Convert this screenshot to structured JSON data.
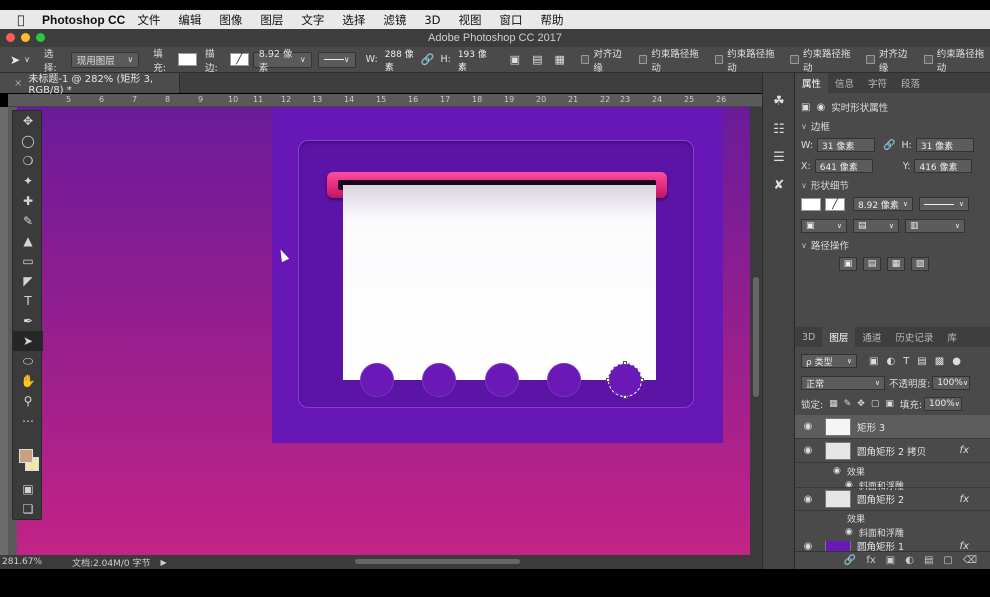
{
  "menu": {
    "app": "Photoshop CC",
    "items": [
      "文件",
      "编辑",
      "图像",
      "图层",
      "文字",
      "选择",
      "滤镜",
      "3D",
      "视图",
      "窗口",
      "帮助"
    ]
  },
  "window": {
    "title": "Adobe Photoshop CC 2017"
  },
  "options": {
    "select_label": "选择:",
    "select_value": "现用图层",
    "fill_label": "填充:",
    "stroke_label": "描边:",
    "stroke_size": "8.92 像素",
    "w_label": "W:",
    "w_value": "288 像素",
    "h_label": "H:",
    "h_value": "193 像素",
    "align_edges": "对齐边缘",
    "constrain_path": "约束路径拖动",
    "constrain_path2": "约束路径拖动",
    "constrain_path3": "约束路径拖动",
    "align_edges2": "对齐边缘",
    "constrain_path4": "约束路径拖动"
  },
  "document": {
    "tab_title": "未标题-1 @ 282% (矩形 3, RGB/8) *",
    "ruler_ticks": [
      "5",
      "6",
      "7",
      "8",
      "9",
      "10",
      "11",
      "12",
      "13",
      "14",
      "15",
      "16",
      "17",
      "18",
      "19",
      "20",
      "21",
      "22",
      "23",
      "24",
      "25",
      "26"
    ]
  },
  "status": {
    "zoom": "281.67%",
    "doc_info": "文档:2.04M/0 字节"
  },
  "properties": {
    "tabs": [
      "属性",
      "信息",
      "字符",
      "段落"
    ],
    "header": "实时形状属性",
    "section_frame": "边框",
    "w_label": "W:",
    "w": "31 像素",
    "h_label": "H:",
    "h": "31 像素",
    "x_label": "X:",
    "x": "641 像素",
    "y_label": "Y:",
    "y": "416 像素",
    "section_shape": "形状细节",
    "stroke_width": "8.92 像素",
    "section_path_ops": "路径操作"
  },
  "layers_panel": {
    "tabs": [
      "3D",
      "图层",
      "通道",
      "历史记录",
      "库"
    ],
    "filter_kind": "ρ 类型",
    "blend_mode": "正常",
    "opacity_label": "不透明度:",
    "opacity": "100%",
    "lock_label": "锁定:",
    "fill_label": "填充:",
    "fill": "100%",
    "layers": [
      {
        "name": "矩形 3",
        "selected": true,
        "fx": ""
      },
      {
        "name": "圆角矩形 2 拷贝",
        "selected": false,
        "fx": "fx"
      },
      {
        "name": "圆角矩形 2",
        "selected": false,
        "fx": "fx"
      },
      {
        "name": "圆角矩形 1",
        "selected": false,
        "fx": "fx"
      }
    ],
    "effects_label": "效果",
    "bevel_label": "斜面和浮雕",
    "effects_label2": "效果",
    "bevel_label2": "斜面和浮雕"
  },
  "colors": {
    "accent_pink": "#e0287e",
    "purple": "#6717b6",
    "foreground_swatch": "#c9a080",
    "background_swatch": "#efe7b0"
  }
}
